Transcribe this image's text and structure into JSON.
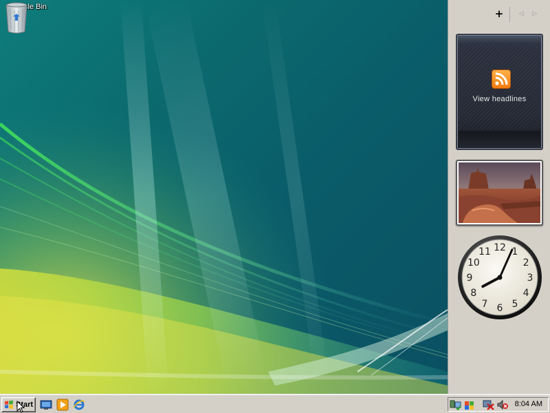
{
  "desktop": {
    "icons": [
      {
        "label": "Recycle Bin",
        "icon": "recycle-bin-icon"
      }
    ]
  },
  "sidebar": {
    "toolbar": {
      "add_symbol": "+",
      "prev_symbol": "◁",
      "next_symbol": "▷"
    },
    "gadgets": {
      "feed": {
        "label": "View headlines",
        "icon": "rss-icon"
      },
      "slideshow": {
        "icon": "desert-landscape-photo"
      },
      "clock": {
        "numerals": [
          "1",
          "2",
          "3",
          "4",
          "5",
          "6",
          "7",
          "8",
          "9",
          "10",
          "11",
          "12"
        ],
        "hour": 8,
        "minute": 4
      }
    }
  },
  "taskbar": {
    "start_label": "Start",
    "quick_launch": [
      "show-desktop-icon",
      "media-player-icon",
      "internet-explorer-icon"
    ],
    "tray_icons": [
      "network-icon",
      "security-shield-icon",
      "network-disconnected-icon",
      "volume-muted-icon"
    ],
    "time": "8:04 AM"
  },
  "colors": {
    "feed_accent": "#f57a10",
    "taskbar": "#d4d0c8",
    "wallpaper": "#0b6a6e"
  }
}
